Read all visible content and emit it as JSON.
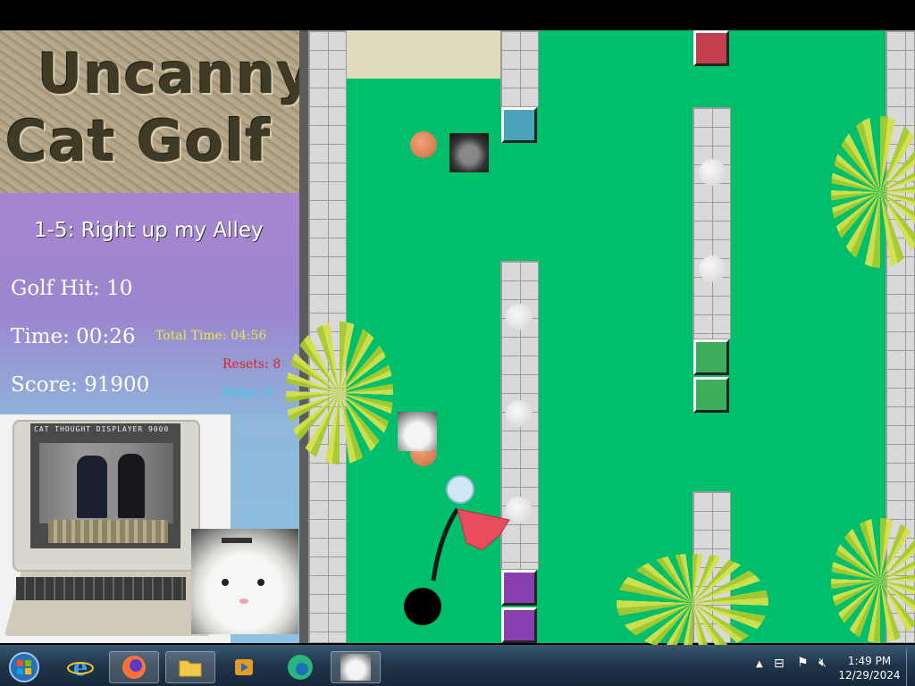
{
  "game": {
    "title_line1": "Uncanny",
    "title_line2": "Cat Golf",
    "level_name": "1-5: Right up my Alley",
    "golf_hit": "Golf Hit: 10",
    "time": "Time: 00:26",
    "total_time": "Total Time: 04:56",
    "resets": "Resets: 8",
    "score": "Score: 91900",
    "skips": "Skips: 0",
    "display_caption": "CAT THOUGHT DISPLAYER 9000"
  },
  "colors": {
    "field_green": "#00bf6c",
    "total_time": "#e8e84a",
    "resets": "#e02020",
    "skips": "#2ed1e8",
    "tile_blue": "#4aa3b8",
    "tile_red": "#c2404e",
    "tile_green": "#3fae5b",
    "tile_purple": "#8a3fb0",
    "flag_red": "#e84d5e"
  },
  "taskbar": {
    "items": [
      {
        "name": "start-button",
        "icon": "windows-orb-icon"
      },
      {
        "name": "internet-explorer",
        "icon": "ie-icon"
      },
      {
        "name": "firefox",
        "icon": "firefox-icon"
      },
      {
        "name": "file-explorer",
        "icon": "folder-icon"
      },
      {
        "name": "media-player",
        "icon": "media-player-icon"
      },
      {
        "name": "edge",
        "icon": "edge-icon"
      },
      {
        "name": "uncanny-cat-golf",
        "icon": "cat-game-icon"
      }
    ],
    "clock_time": "1:49 PM",
    "clock_date": "12/29/2024"
  }
}
